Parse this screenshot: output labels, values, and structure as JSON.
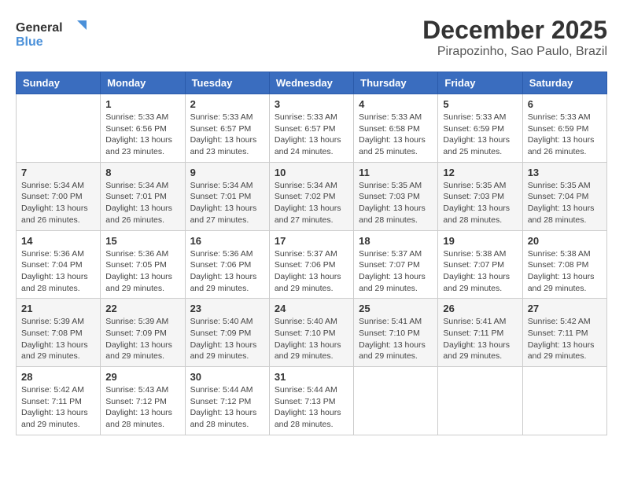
{
  "logo": {
    "line1": "General",
    "line2": "Blue"
  },
  "title": "December 2025",
  "subtitle": "Pirapozinho, Sao Paulo, Brazil",
  "days_of_week": [
    "Sunday",
    "Monday",
    "Tuesday",
    "Wednesday",
    "Thursday",
    "Friday",
    "Saturday"
  ],
  "weeks": [
    [
      {
        "num": "",
        "info": ""
      },
      {
        "num": "1",
        "info": "Sunrise: 5:33 AM\nSunset: 6:56 PM\nDaylight: 13 hours\nand 23 minutes."
      },
      {
        "num": "2",
        "info": "Sunrise: 5:33 AM\nSunset: 6:57 PM\nDaylight: 13 hours\nand 23 minutes."
      },
      {
        "num": "3",
        "info": "Sunrise: 5:33 AM\nSunset: 6:57 PM\nDaylight: 13 hours\nand 24 minutes."
      },
      {
        "num": "4",
        "info": "Sunrise: 5:33 AM\nSunset: 6:58 PM\nDaylight: 13 hours\nand 25 minutes."
      },
      {
        "num": "5",
        "info": "Sunrise: 5:33 AM\nSunset: 6:59 PM\nDaylight: 13 hours\nand 25 minutes."
      },
      {
        "num": "6",
        "info": "Sunrise: 5:33 AM\nSunset: 6:59 PM\nDaylight: 13 hours\nand 26 minutes."
      }
    ],
    [
      {
        "num": "7",
        "info": "Sunrise: 5:34 AM\nSunset: 7:00 PM\nDaylight: 13 hours\nand 26 minutes."
      },
      {
        "num": "8",
        "info": "Sunrise: 5:34 AM\nSunset: 7:01 PM\nDaylight: 13 hours\nand 26 minutes."
      },
      {
        "num": "9",
        "info": "Sunrise: 5:34 AM\nSunset: 7:01 PM\nDaylight: 13 hours\nand 27 minutes."
      },
      {
        "num": "10",
        "info": "Sunrise: 5:34 AM\nSunset: 7:02 PM\nDaylight: 13 hours\nand 27 minutes."
      },
      {
        "num": "11",
        "info": "Sunrise: 5:35 AM\nSunset: 7:03 PM\nDaylight: 13 hours\nand 28 minutes."
      },
      {
        "num": "12",
        "info": "Sunrise: 5:35 AM\nSunset: 7:03 PM\nDaylight: 13 hours\nand 28 minutes."
      },
      {
        "num": "13",
        "info": "Sunrise: 5:35 AM\nSunset: 7:04 PM\nDaylight: 13 hours\nand 28 minutes."
      }
    ],
    [
      {
        "num": "14",
        "info": "Sunrise: 5:36 AM\nSunset: 7:04 PM\nDaylight: 13 hours\nand 28 minutes."
      },
      {
        "num": "15",
        "info": "Sunrise: 5:36 AM\nSunset: 7:05 PM\nDaylight: 13 hours\nand 29 minutes."
      },
      {
        "num": "16",
        "info": "Sunrise: 5:36 AM\nSunset: 7:06 PM\nDaylight: 13 hours\nand 29 minutes."
      },
      {
        "num": "17",
        "info": "Sunrise: 5:37 AM\nSunset: 7:06 PM\nDaylight: 13 hours\nand 29 minutes."
      },
      {
        "num": "18",
        "info": "Sunrise: 5:37 AM\nSunset: 7:07 PM\nDaylight: 13 hours\nand 29 minutes."
      },
      {
        "num": "19",
        "info": "Sunrise: 5:38 AM\nSunset: 7:07 PM\nDaylight: 13 hours\nand 29 minutes."
      },
      {
        "num": "20",
        "info": "Sunrise: 5:38 AM\nSunset: 7:08 PM\nDaylight: 13 hours\nand 29 minutes."
      }
    ],
    [
      {
        "num": "21",
        "info": "Sunrise: 5:39 AM\nSunset: 7:08 PM\nDaylight: 13 hours\nand 29 minutes."
      },
      {
        "num": "22",
        "info": "Sunrise: 5:39 AM\nSunset: 7:09 PM\nDaylight: 13 hours\nand 29 minutes."
      },
      {
        "num": "23",
        "info": "Sunrise: 5:40 AM\nSunset: 7:09 PM\nDaylight: 13 hours\nand 29 minutes."
      },
      {
        "num": "24",
        "info": "Sunrise: 5:40 AM\nSunset: 7:10 PM\nDaylight: 13 hours\nand 29 minutes."
      },
      {
        "num": "25",
        "info": "Sunrise: 5:41 AM\nSunset: 7:10 PM\nDaylight: 13 hours\nand 29 minutes."
      },
      {
        "num": "26",
        "info": "Sunrise: 5:41 AM\nSunset: 7:11 PM\nDaylight: 13 hours\nand 29 minutes."
      },
      {
        "num": "27",
        "info": "Sunrise: 5:42 AM\nSunset: 7:11 PM\nDaylight: 13 hours\nand 29 minutes."
      }
    ],
    [
      {
        "num": "28",
        "info": "Sunrise: 5:42 AM\nSunset: 7:11 PM\nDaylight: 13 hours\nand 29 minutes."
      },
      {
        "num": "29",
        "info": "Sunrise: 5:43 AM\nSunset: 7:12 PM\nDaylight: 13 hours\nand 28 minutes."
      },
      {
        "num": "30",
        "info": "Sunrise: 5:44 AM\nSunset: 7:12 PM\nDaylight: 13 hours\nand 28 minutes."
      },
      {
        "num": "31",
        "info": "Sunrise: 5:44 AM\nSunset: 7:13 PM\nDaylight: 13 hours\nand 28 minutes."
      },
      {
        "num": "",
        "info": ""
      },
      {
        "num": "",
        "info": ""
      },
      {
        "num": "",
        "info": ""
      }
    ]
  ]
}
